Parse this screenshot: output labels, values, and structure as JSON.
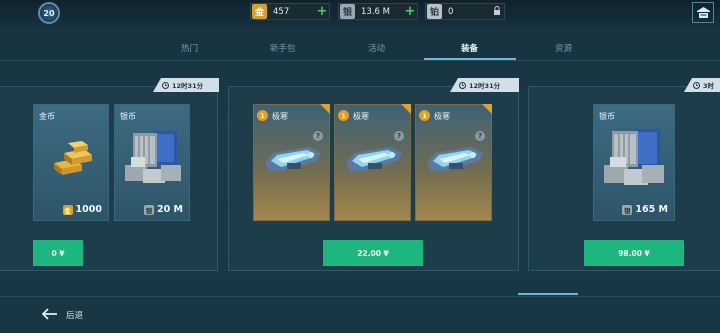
{
  "header": {
    "level": "20",
    "gold": {
      "icon": "金",
      "value": "457"
    },
    "silver": {
      "icon": "银",
      "value": "13.6 M"
    },
    "platinum": {
      "icon": "铂",
      "value": "0"
    }
  },
  "tabs": [
    {
      "label": "热门",
      "active": false
    },
    {
      "label": "新手包",
      "active": false
    },
    {
      "label": "活动",
      "active": false
    },
    {
      "label": "装备",
      "active": true
    },
    {
      "label": "资源",
      "active": false
    }
  ],
  "panels": [
    {
      "timer": "12时31分",
      "cards": [
        {
          "label": "金币",
          "amount": "1000",
          "currency_icon": "金"
        },
        {
          "label": "银币",
          "amount": "20 M",
          "currency_icon": "银"
        }
      ],
      "price": "0 ¥"
    },
    {
      "timer": "12时31分",
      "cards": [
        {
          "badge": "1",
          "label": "极寒"
        },
        {
          "badge": "1",
          "label": "极寒"
        },
        {
          "badge": "1",
          "label": "极寒"
        }
      ],
      "price": "22.00 ¥"
    },
    {
      "timer": "3时",
      "cards": [
        {
          "label": "银币",
          "amount": "165 M",
          "currency_icon": "银"
        }
      ],
      "price": "98.00 ¥"
    }
  ],
  "footer": {
    "back_label": "后退"
  },
  "colors": {
    "accent": "#1cb77e",
    "gold": "#e2a01c",
    "tab_highlight": "#6fb9d6"
  }
}
